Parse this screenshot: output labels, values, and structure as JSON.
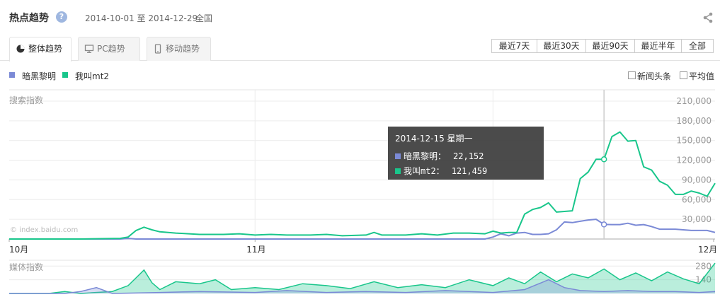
{
  "header": {
    "title": "热点趋势",
    "help": "?",
    "date_range": "2014-10-01 至 2014-12-29",
    "region": "全国"
  },
  "tabs": [
    {
      "label": "整体趋势",
      "icon": "pie-chart-icon",
      "active": true
    },
    {
      "label": "PC趋势",
      "icon": "monitor-icon",
      "active": false
    },
    {
      "label": "移动趋势",
      "icon": "mobile-icon",
      "active": false
    }
  ],
  "range_buttons": [
    "最近7天",
    "最近30天",
    "最近90天",
    "最近半年",
    "全部"
  ],
  "options": [
    "新闻头条",
    "平均值"
  ],
  "colors": {
    "series1": "#7b8ad6",
    "series2": "#19c68b",
    "grid": "#ececec",
    "axis": "#aaaaaa"
  },
  "chart_data": [
    {
      "type": "line",
      "title": "搜索指数",
      "watermark_text": "© index.baidu.com",
      "x_labels": [
        "10月",
        "11月",
        "12月"
      ],
      "y_ticks": [
        "210,000",
        "180,000",
        "150,000",
        "120,000",
        "90,000",
        "60,000",
        "30,000"
      ],
      "ylim": [
        0,
        210000
      ],
      "xlim": [
        "2014-10-01",
        "2014-12-29"
      ],
      "grid": true,
      "series": [
        {
          "name": "暗黑黎明",
          "points": [
            [
              "2014-10-01",
              0
            ],
            [
              "2014-10-05",
              0
            ],
            [
              "2014-10-10",
              0
            ],
            [
              "2014-10-15",
              0
            ],
            [
              "2014-10-16",
              1000
            ],
            [
              "2014-10-17",
              0
            ],
            [
              "2014-10-25",
              0
            ],
            [
              "2014-11-01",
              0
            ],
            [
              "2014-11-10",
              0
            ],
            [
              "2014-11-15",
              0
            ],
            [
              "2014-11-20",
              0
            ],
            [
              "2014-11-25",
              0
            ],
            [
              "2014-11-30",
              0
            ],
            [
              "2014-12-01",
              3000
            ],
            [
              "2014-12-02",
              8000
            ],
            [
              "2014-12-03",
              5000
            ],
            [
              "2014-12-04",
              9000
            ],
            [
              "2014-12-05",
              10000
            ],
            [
              "2014-12-06",
              7000
            ],
            [
              "2014-12-07",
              7000
            ],
            [
              "2014-12-08",
              8000
            ],
            [
              "2014-12-09",
              14000
            ],
            [
              "2014-12-10",
              26000
            ],
            [
              "2014-12-11",
              25000
            ],
            [
              "2014-12-12",
              27000
            ],
            [
              "2014-12-13",
              29000
            ],
            [
              "2014-12-14",
              30000
            ],
            [
              "2014-12-15",
              22152
            ],
            [
              "2014-12-16",
              22000
            ],
            [
              "2014-12-17",
              22000
            ],
            [
              "2014-12-18",
              24000
            ],
            [
              "2014-12-19",
              21000
            ],
            [
              "2014-12-20",
              22000
            ],
            [
              "2014-12-21",
              19000
            ],
            [
              "2014-12-22",
              15000
            ],
            [
              "2014-12-23",
              15000
            ],
            [
              "2014-12-24",
              15000
            ],
            [
              "2014-12-25",
              14000
            ],
            [
              "2014-12-26",
              13000
            ],
            [
              "2014-12-27",
              13000
            ],
            [
              "2014-12-28",
              13000
            ],
            [
              "2014-12-29",
              10000
            ]
          ]
        },
        {
          "name": "我叫mt2",
          "points": [
            [
              "2014-10-01",
              0
            ],
            [
              "2014-10-05",
              0
            ],
            [
              "2014-10-10",
              0
            ],
            [
              "2014-10-15",
              1000
            ],
            [
              "2014-10-16",
              3000
            ],
            [
              "2014-10-17",
              13000
            ],
            [
              "2014-10-18",
              18000
            ],
            [
              "2014-10-19",
              14000
            ],
            [
              "2014-10-20",
              11000
            ],
            [
              "2014-10-22",
              9000
            ],
            [
              "2014-10-25",
              7000
            ],
            [
              "2014-10-28",
              7000
            ],
            [
              "2014-10-30",
              8000
            ],
            [
              "2014-11-01",
              6000
            ],
            [
              "2014-11-03",
              7000
            ],
            [
              "2014-11-05",
              6000
            ],
            [
              "2014-11-08",
              6000
            ],
            [
              "2014-11-10",
              7000
            ],
            [
              "2014-11-12",
              5000
            ],
            [
              "2014-11-15",
              6000
            ],
            [
              "2014-11-16",
              10000
            ],
            [
              "2014-11-17",
              6000
            ],
            [
              "2014-11-20",
              6000
            ],
            [
              "2014-11-22",
              8000
            ],
            [
              "2014-11-24",
              6000
            ],
            [
              "2014-11-26",
              9000
            ],
            [
              "2014-11-28",
              9000
            ],
            [
              "2014-11-30",
              8000
            ],
            [
              "2014-12-01",
              12000
            ],
            [
              "2014-12-02",
              9000
            ],
            [
              "2014-12-03",
              10000
            ],
            [
              "2014-12-04",
              10000
            ],
            [
              "2014-12-05",
              38000
            ],
            [
              "2014-12-06",
              45000
            ],
            [
              "2014-12-07",
              48000
            ],
            [
              "2014-12-08",
              55000
            ],
            [
              "2014-12-09",
              41000
            ],
            [
              "2014-12-10",
              42000
            ],
            [
              "2014-12-11",
              43000
            ],
            [
              "2014-12-12",
              92000
            ],
            [
              "2014-12-13",
              102000
            ],
            [
              "2014-12-14",
              121459
            ],
            [
              "2014-12-15",
              121459
            ],
            [
              "2014-12-16",
              156000
            ],
            [
              "2014-12-17",
              163000
            ],
            [
              "2014-12-18",
              149000
            ],
            [
              "2014-12-19",
              150000
            ],
            [
              "2014-12-20",
              110000
            ],
            [
              "2014-12-21",
              105000
            ],
            [
              "2014-12-22",
              88000
            ],
            [
              "2014-12-23",
              82000
            ],
            [
              "2014-12-24",
              68000
            ],
            [
              "2014-12-25",
              68000
            ],
            [
              "2014-12-26",
              73000
            ],
            [
              "2014-12-27",
              70000
            ],
            [
              "2014-12-28",
              65000
            ],
            [
              "2014-12-29",
              85000
            ]
          ]
        }
      ],
      "tooltip": {
        "date": "2014-12-15 星期一",
        "rows": [
          {
            "label": "暗黑黎明：",
            "value": "22,152"
          },
          {
            "label": "我叫mt2：",
            "value": "121,459"
          }
        ]
      }
    },
    {
      "type": "area",
      "title": "媒体指数",
      "y_ticks": [
        "280",
        "140"
      ],
      "ylim": [
        0,
        340
      ],
      "xlim": [
        "2014-10-01",
        "2014-12-29"
      ],
      "series": [
        {
          "name": "暗黑黎明",
          "points": [
            [
              "2014-10-01",
              0
            ],
            [
              "2014-10-08",
              0
            ],
            [
              "2014-10-10",
              20
            ],
            [
              "2014-10-12",
              60
            ],
            [
              "2014-10-14",
              0
            ],
            [
              "2014-10-20",
              10
            ],
            [
              "2014-10-25",
              20
            ],
            [
              "2014-11-01",
              10
            ],
            [
              "2014-11-05",
              30
            ],
            [
              "2014-11-10",
              10
            ],
            [
              "2014-11-15",
              20
            ],
            [
              "2014-11-20",
              10
            ],
            [
              "2014-11-25",
              30
            ],
            [
              "2014-12-01",
              10
            ],
            [
              "2014-12-05",
              40
            ],
            [
              "2014-12-08",
              140
            ],
            [
              "2014-12-10",
              60
            ],
            [
              "2014-12-12",
              30
            ],
            [
              "2014-12-15",
              20
            ],
            [
              "2014-12-18",
              30
            ],
            [
              "2014-12-21",
              20
            ],
            [
              "2014-12-24",
              20
            ],
            [
              "2014-12-27",
              10
            ],
            [
              "2014-12-29",
              20
            ]
          ]
        },
        {
          "name": "我叫mt2",
          "points": [
            [
              "2014-10-01",
              0
            ],
            [
              "2014-10-06",
              0
            ],
            [
              "2014-10-08",
              20
            ],
            [
              "2014-10-10",
              0
            ],
            [
              "2014-10-14",
              20
            ],
            [
              "2014-10-16",
              80
            ],
            [
              "2014-10-17",
              160
            ],
            [
              "2014-10-18",
              240
            ],
            [
              "2014-10-19",
              110
            ],
            [
              "2014-10-20",
              40
            ],
            [
              "2014-10-22",
              120
            ],
            [
              "2014-10-25",
              100
            ],
            [
              "2014-10-27",
              140
            ],
            [
              "2014-10-29",
              40
            ],
            [
              "2014-11-01",
              60
            ],
            [
              "2014-11-04",
              40
            ],
            [
              "2014-11-07",
              100
            ],
            [
              "2014-11-10",
              80
            ],
            [
              "2014-11-13",
              50
            ],
            [
              "2014-11-16",
              120
            ],
            [
              "2014-11-19",
              60
            ],
            [
              "2014-11-22",
              90
            ],
            [
              "2014-11-25",
              60
            ],
            [
              "2014-11-28",
              140
            ],
            [
              "2014-12-01",
              80
            ],
            [
              "2014-12-03",
              160
            ],
            [
              "2014-12-05",
              100
            ],
            [
              "2014-12-07",
              220
            ],
            [
              "2014-12-09",
              120
            ],
            [
              "2014-12-11",
              200
            ],
            [
              "2014-12-13",
              160
            ],
            [
              "2014-12-15",
              250
            ],
            [
              "2014-12-17",
              140
            ],
            [
              "2014-12-19",
              210
            ],
            [
              "2014-12-21",
              130
            ],
            [
              "2014-12-23",
              220
            ],
            [
              "2014-12-25",
              150
            ],
            [
              "2014-12-27",
              100
            ],
            [
              "2014-12-29",
              310
            ]
          ]
        }
      ]
    }
  ]
}
